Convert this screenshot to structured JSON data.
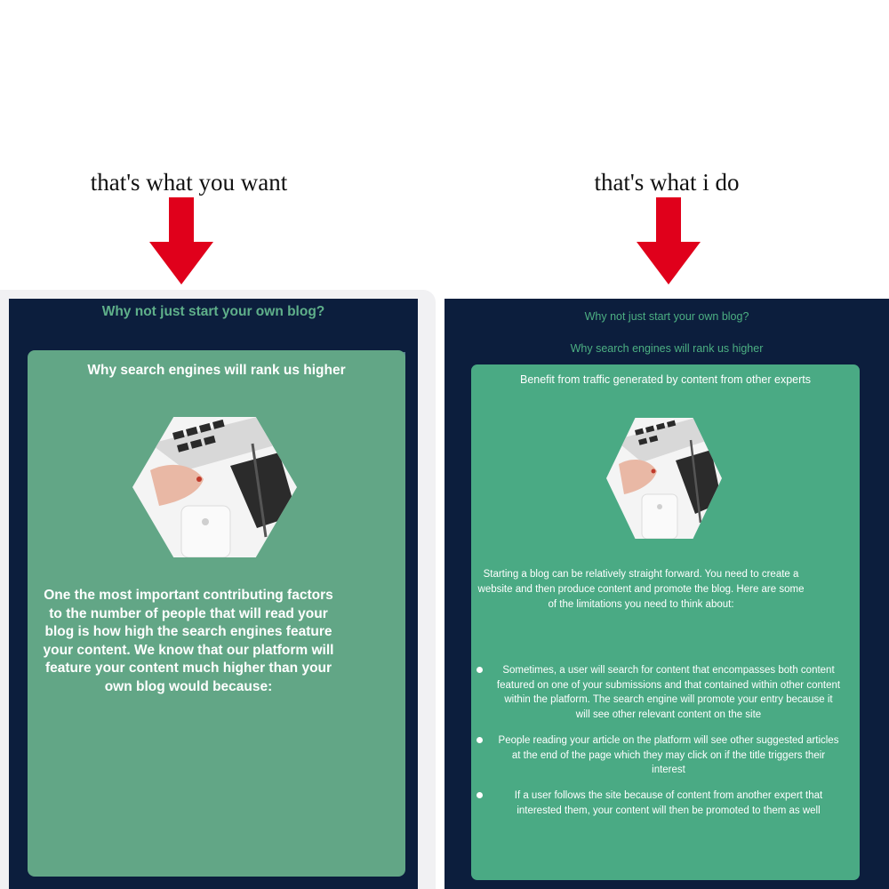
{
  "captions": {
    "left": "that's what you want",
    "right": "that's what i do"
  },
  "colors": {
    "arrow": "#e0001b",
    "navy": "#0c1e3d",
    "card_left": "#62a686",
    "card_right": "#4aaa84",
    "heading_green": "#4caf82"
  },
  "left_panel": {
    "heading": "Why not just start your own blog?",
    "card_title": "Why search engines will rank us higher",
    "image": "laptop-notebook-hexagon-image",
    "body": "One the most important contributing factors to the number of people that will read your blog is how high the search engines feature your content. We know that our platform will feature your content much higher than your own blog would because:"
  },
  "right_panel": {
    "heading_primary": "Why not just start your own blog?",
    "heading_secondary": "Why search engines will rank us higher",
    "card_title": "Benefit from traffic generated by content from other experts",
    "image": "laptop-notebook-hexagon-image",
    "intro": "Starting a blog can be relatively straight forward. You need to create a website and then produce content and promote the blog. Here are some of the limitations you need to think about:",
    "bullets": [
      "Sometimes, a user will search for content that encompasses both content featured on one of your submissions and that contained within other content within the platform. The search engine will promote your entry because it will see other relevant content on the site",
      "People reading your article on the platform will see other suggested articles at the end of the page which they may click on if the title triggers their interest",
      "If a user follows the site because of content from another expert that interested them, your content will then be promoted to them as well"
    ]
  }
}
